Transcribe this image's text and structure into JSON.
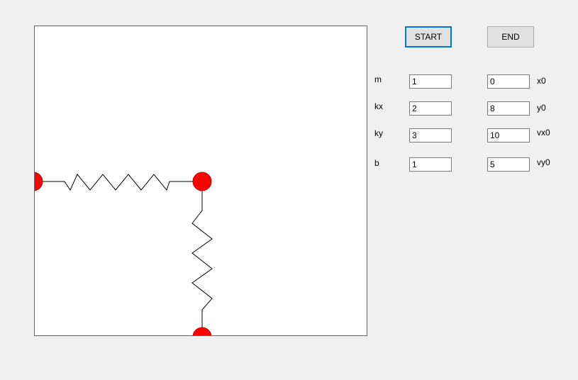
{
  "buttons": {
    "start": "START",
    "end": "END"
  },
  "params": {
    "m": {
      "label": "m",
      "value": "1"
    },
    "kx": {
      "label": "kx",
      "value": "2"
    },
    "ky": {
      "label": "ky",
      "value": "3"
    },
    "b": {
      "label": "b",
      "value": "1"
    },
    "x0": {
      "label": "x0",
      "value": "0"
    },
    "y0": {
      "label": "y0",
      "value": "8"
    },
    "vx0": {
      "label": "vx0",
      "value": "10"
    },
    "vy0": {
      "label": "vy0",
      "value": "5"
    }
  },
  "colors": {
    "mass": "#ff0000",
    "spring": "#000000"
  }
}
